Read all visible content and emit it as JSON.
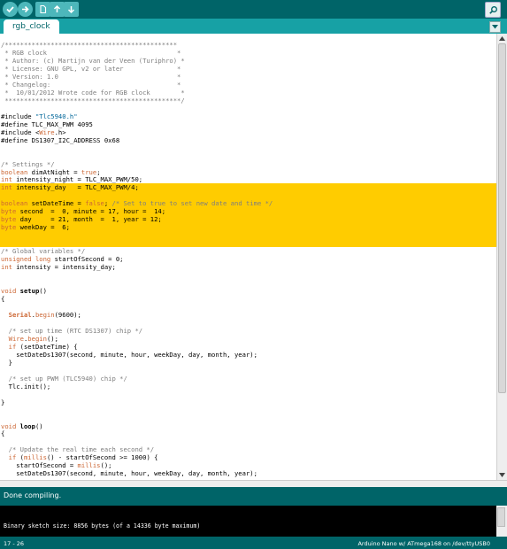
{
  "toolbar": {
    "buttons": [
      "verify",
      "upload",
      "new",
      "open",
      "save"
    ],
    "serial_monitor": "serial-monitor"
  },
  "tab": {
    "label": "rgb_clock"
  },
  "code": {
    "highlight_lines": [
      18,
      19,
      20,
      21,
      22,
      23,
      24,
      25
    ],
    "lines": [
      [
        [
          "c-com",
          "/*********************************************"
        ]
      ],
      [
        [
          "c-com",
          " * RGB clock                                  *"
        ]
      ],
      [
        [
          "c-com",
          " * Author: (c) Martijn van der Veen (Turiphro) *"
        ]
      ],
      [
        [
          "c-com",
          " * License: GNU GPL, v2 or later              *"
        ]
      ],
      [
        [
          "c-com",
          " * Version: 1.0                               *"
        ]
      ],
      [
        [
          "c-com",
          " * Changelog:                                 *"
        ]
      ],
      [
        [
          "c-com",
          " *  10/01/2012 Wrote code for RGB clock        *"
        ]
      ],
      [
        [
          "c-com",
          " **********************************************/"
        ]
      ],
      [
        [
          "",
          ""
        ]
      ],
      [
        [
          "c-pp",
          "#include "
        ],
        [
          "c-str",
          "\"Tlc5940.h\""
        ]
      ],
      [
        [
          "c-pp",
          "#define TLC_MAX_PWM 4095"
        ]
      ],
      [
        [
          "c-pp",
          "#include <"
        ],
        [
          "c-fn",
          "Wire"
        ],
        [
          "c-pp",
          ".h>"
        ]
      ],
      [
        [
          "c-pp",
          "#define DS1307_I2C_ADDRESS 0x68"
        ]
      ],
      [
        [
          "",
          ""
        ]
      ],
      [
        [
          "",
          ""
        ]
      ],
      [
        [
          "c-com",
          "/* Settings */"
        ]
      ],
      [
        [
          "c-kw",
          "boolean"
        ],
        [
          "",
          " dimAtNight = "
        ],
        [
          "c-kw",
          "true"
        ],
        [
          "",
          ";"
        ]
      ],
      [
        [
          "c-kw",
          "int"
        ],
        [
          "",
          " intensity_night = TLC_MAX_PWM/50;"
        ]
      ],
      [
        [
          "c-kw",
          "int"
        ],
        [
          "",
          " intensity_day   = TLC_MAX_PWM/4;"
        ]
      ],
      [
        [
          "",
          ""
        ]
      ],
      [
        [
          "c-kw",
          "boolean"
        ],
        [
          "",
          " setDateTime = "
        ],
        [
          "c-kw",
          "false"
        ],
        [
          "",
          "; "
        ],
        [
          "c-com",
          "/* Set to true to set new date and time */"
        ]
      ],
      [
        [
          "c-kw",
          "byte"
        ],
        [
          "",
          " second  =  0, minute = 17, hour =  14;"
        ]
      ],
      [
        [
          "c-kw",
          "byte"
        ],
        [
          "",
          " day     = 21, month  =  1, year = 12;"
        ]
      ],
      [
        [
          "c-kw",
          "byte"
        ],
        [
          "",
          " weekDay =  6;"
        ]
      ],
      [
        [
          "",
          ""
        ]
      ],
      [
        [
          "",
          ""
        ]
      ],
      [
        [
          "c-com",
          "/* Global variables */"
        ]
      ],
      [
        [
          "c-kw",
          "unsigned long"
        ],
        [
          "",
          " startOfSecond = 0;"
        ]
      ],
      [
        [
          "c-kw",
          "int"
        ],
        [
          "",
          " intensity = intensity_day;"
        ]
      ],
      [
        [
          "",
          ""
        ]
      ],
      [
        [
          "",
          ""
        ]
      ],
      [
        [
          "c-kw",
          "void"
        ],
        [
          "",
          " "
        ],
        [
          "c-b",
          "setup"
        ],
        [
          "",
          "()"
        ]
      ],
      [
        [
          "",
          "{"
        ]
      ],
      [
        [
          "",
          ""
        ]
      ],
      [
        [
          "",
          "  "
        ],
        [
          "c-fn c-b",
          "Serial"
        ],
        [
          "",
          "."
        ],
        [
          "c-fn",
          "begin"
        ],
        [
          "",
          "(9600);"
        ]
      ],
      [
        [
          "",
          ""
        ]
      ],
      [
        [
          "c-com",
          "  /* set up time (RTC DS1307) chip */"
        ]
      ],
      [
        [
          "",
          "  "
        ],
        [
          "c-fn",
          "Wire"
        ],
        [
          "",
          "."
        ],
        [
          "c-fn",
          "begin"
        ],
        [
          "",
          "();"
        ]
      ],
      [
        [
          "",
          "  "
        ],
        [
          "c-kw",
          "if"
        ],
        [
          "",
          " (setDateTime) {"
        ]
      ],
      [
        [
          "",
          "    setDateDs1307(second, minute, hour, weekDay, day, month, year);"
        ]
      ],
      [
        [
          "",
          "  }"
        ]
      ],
      [
        [
          "",
          ""
        ]
      ],
      [
        [
          "c-com",
          "  /* set up PWM (TLC5940) chip */"
        ]
      ],
      [
        [
          "",
          "  Tlc.init();"
        ]
      ],
      [
        [
          "",
          ""
        ]
      ],
      [
        [
          "",
          "}"
        ]
      ],
      [
        [
          "",
          ""
        ]
      ],
      [
        [
          "",
          ""
        ]
      ],
      [
        [
          "c-kw",
          "void"
        ],
        [
          "",
          " "
        ],
        [
          "c-b",
          "loop"
        ],
        [
          "",
          "()"
        ]
      ],
      [
        [
          "",
          "{"
        ]
      ],
      [
        [
          "",
          ""
        ]
      ],
      [
        [
          "c-com",
          "  /* Update the real time each second */"
        ]
      ],
      [
        [
          "",
          "  "
        ],
        [
          "c-kw",
          "if"
        ],
        [
          "",
          " ("
        ],
        [
          "c-fn",
          "millis"
        ],
        [
          "",
          "() - startOfSecond >= 1000) {"
        ]
      ],
      [
        [
          "",
          "    startOfSecond = "
        ],
        [
          "c-fn",
          "millis"
        ],
        [
          "",
          "();"
        ]
      ],
      [
        [
          "",
          "    setDateDs1307(second, minute, hour, weekDay, day, month, year);"
        ]
      ]
    ]
  },
  "status": {
    "text": "Done compiling."
  },
  "console": {
    "text": "Binary sketch size: 8856 bytes (of a 14336 byte maximum)"
  },
  "footer": {
    "position": "17 - 26",
    "board": "Arduino Nano w/ ATmega168 on /dev/ttyUSB0"
  }
}
